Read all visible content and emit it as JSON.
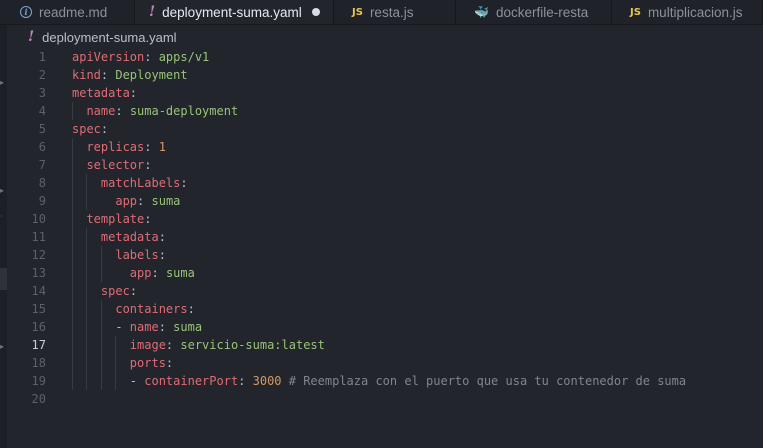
{
  "tabs": [
    {
      "label": "readme.md",
      "icon": "info-icon",
      "active": false
    },
    {
      "label": "deployment-suma.yaml",
      "icon": "yaml-exclamation-icon",
      "active": true,
      "modified": true
    },
    {
      "label": "resta.js",
      "icon": "js-icon",
      "active": false
    },
    {
      "label": "dockerfile-resta",
      "icon": "docker-whale-icon",
      "active": false
    },
    {
      "label": "multiplicacion.js",
      "icon": "js-icon",
      "active": false
    }
  ],
  "breadcrumb": {
    "file": "deployment-suma.yaml"
  },
  "editor": {
    "current_line": 17,
    "lines": [
      {
        "n": "1",
        "indent": "",
        "key": "apiVersion",
        "sep": ": ",
        "val": "apps/v1",
        "vt": "s"
      },
      {
        "n": "2",
        "indent": "",
        "key": "kind",
        "sep": ": ",
        "val": "Deployment",
        "vt": "s"
      },
      {
        "n": "3",
        "indent": "",
        "key": "metadata",
        "sep": ":",
        "val": "",
        "vt": "s"
      },
      {
        "n": "4",
        "indent": "  ",
        "key": "name",
        "sep": ": ",
        "val": "suma-deployment",
        "vt": "s"
      },
      {
        "n": "5",
        "indent": "",
        "key": "spec",
        "sep": ":",
        "val": "",
        "vt": "s"
      },
      {
        "n": "6",
        "indent": "  ",
        "key": "replicas",
        "sep": ": ",
        "val": "1",
        "vt": "n"
      },
      {
        "n": "7",
        "indent": "  ",
        "key": "selector",
        "sep": ":",
        "val": "",
        "vt": "s"
      },
      {
        "n": "8",
        "indent": "    ",
        "key": "matchLabels",
        "sep": ":",
        "val": "",
        "vt": "s"
      },
      {
        "n": "9",
        "indent": "      ",
        "key": "app",
        "sep": ": ",
        "val": "suma",
        "vt": "s"
      },
      {
        "n": "10",
        "indent": "  ",
        "key": "template",
        "sep": ":",
        "val": "",
        "vt": "s"
      },
      {
        "n": "11",
        "indent": "    ",
        "key": "metadata",
        "sep": ":",
        "val": "",
        "vt": "s"
      },
      {
        "n": "12",
        "indent": "      ",
        "key": "labels",
        "sep": ":",
        "val": "",
        "vt": "s"
      },
      {
        "n": "13",
        "indent": "        ",
        "key": "app",
        "sep": ": ",
        "val": "suma",
        "vt": "s"
      },
      {
        "n": "14",
        "indent": "    ",
        "key": "spec",
        "sep": ":",
        "val": "",
        "vt": "s"
      },
      {
        "n": "15",
        "indent": "      ",
        "key": "containers",
        "sep": ":",
        "val": "",
        "vt": "s"
      },
      {
        "n": "16",
        "indent": "      - ",
        "key": "name",
        "sep": ": ",
        "val": "suma",
        "vt": "s"
      },
      {
        "n": "17",
        "indent": "        ",
        "key": "image",
        "sep": ": ",
        "val": "servicio-suma:latest",
        "vt": "s"
      },
      {
        "n": "18",
        "indent": "        ",
        "key": "ports",
        "sep": ":",
        "val": "",
        "vt": "s"
      },
      {
        "n": "19",
        "indent": "        - ",
        "key": "containerPort",
        "sep": ": ",
        "val": "3000",
        "vt": "n",
        "comment": " # Reemplaza con el puerto que usa tu contenedor de suma"
      },
      {
        "n": "20",
        "indent": "",
        "key": "",
        "sep": "",
        "val": "",
        "vt": "s"
      }
    ]
  }
}
